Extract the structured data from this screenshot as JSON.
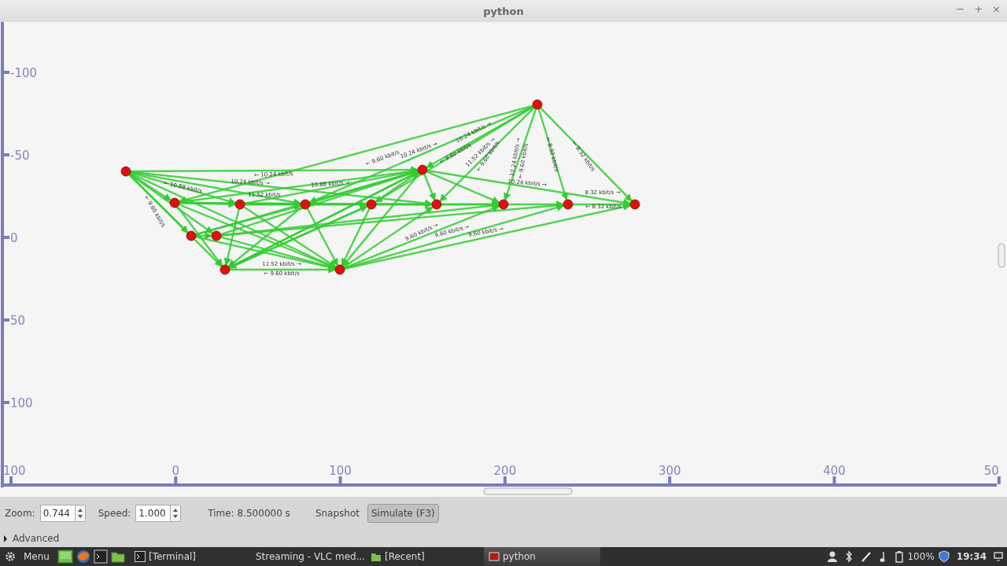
{
  "window": {
    "title": "python",
    "controls": [
      "−",
      "+",
      "×"
    ]
  },
  "canvas": {
    "y_ticks": [
      "-100",
      "-50",
      "0",
      "50",
      "100"
    ],
    "x_ticks": [
      "100",
      "0",
      "100",
      "200",
      "300",
      "400",
      "50"
    ],
    "link_labels": [
      "← 10.24 kbit/s",
      "10.24 kbit/s →",
      "10.88 kbit/s →",
      "11.52 kbit/s →",
      "← 9.60 kbit/s",
      "← 9.60 kbit/s",
      "10.24 kbit/s →",
      "10.24 kbit/s →",
      "← 9.60 kbit/s",
      "11.52 kbit/s →",
      "← 9.60 kbit/s",
      "10.24 kbit/s →",
      "← 9.60 kbit/s",
      "← 8.32 kbit/s",
      "← 8.32 kbit/s",
      "10.24 kbit/s →",
      "8.32 kbit/s →",
      "← 8.32 kbit/s",
      "9.60 kbit/s →",
      "9.60 kbit/s →",
      "9.60 kbit/s →",
      "← 10.88 kbit/s",
      "11.52 kbit/s",
      "← 9.60 kbit/s"
    ]
  },
  "controls": {
    "zoom_label": "Zoom:",
    "zoom_value": "0.744",
    "speed_label": "Speed:",
    "speed_value": "1.000",
    "time": "Time: 8.500000 s",
    "snapshot": "Snapshot",
    "simulate": {
      "label": "Simulate (F3)",
      "selected": true
    }
  },
  "advanced": {
    "label": "Advanced",
    "expanded": false
  },
  "taskbar": {
    "menu": "Menu",
    "windows": [
      {
        "kind": "terminal",
        "label": "[Terminal]",
        "selected": false
      },
      {
        "kind": "vlc",
        "label": "Streaming - VLC med...",
        "selected": false
      },
      {
        "kind": "folder",
        "label": "[Recent]",
        "selected": false
      },
      {
        "kind": "python",
        "label": "python",
        "selected": true
      }
    ],
    "battery": "100%",
    "clock": "19:34"
  }
}
